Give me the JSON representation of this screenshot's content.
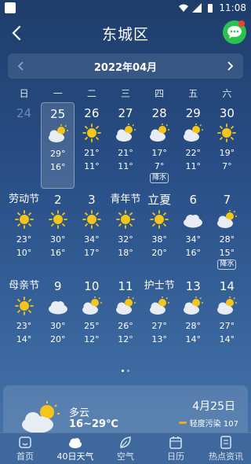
{
  "status": {
    "time": "11:08"
  },
  "header": {
    "title": "东城区"
  },
  "month_bar": {
    "label": "2022年04月"
  },
  "weekdays": [
    "日",
    "一",
    "二",
    "三",
    "四",
    "五",
    "六"
  ],
  "days": [
    {
      "day": "24",
      "dim": true
    },
    {
      "day": "25",
      "icon": "partly-cloudy-icon",
      "high": "29°",
      "low": "16°",
      "selected": true
    },
    {
      "day": "26",
      "icon": "sun-icon",
      "high": "21°",
      "low": "11°"
    },
    {
      "day": "27",
      "icon": "partly-cloudy-icon",
      "high": "21°",
      "low": "11°"
    },
    {
      "day": "28",
      "icon": "partly-cloudy-icon",
      "high": "17°",
      "low": "7°",
      "badge": "降水"
    },
    {
      "day": "29",
      "icon": "partly-cloudy-icon",
      "high": "22°",
      "low": "11°"
    },
    {
      "day": "30",
      "icon": "sun-icon",
      "high": "19°",
      "low": "7°"
    },
    {
      "day": "劳动节",
      "icon": "sun-icon",
      "high": "23°",
      "low": "10°"
    },
    {
      "day": "2",
      "icon": "sun-icon",
      "high": "30°",
      "low": "16°"
    },
    {
      "day": "3",
      "icon": "sun-icon",
      "high": "34°",
      "low": "17°"
    },
    {
      "day": "青年节",
      "icon": "sun-icon",
      "high": "32°",
      "low": "18°"
    },
    {
      "day": "立夏",
      "icon": "sun-icon",
      "high": "38°",
      "low": "20°"
    },
    {
      "day": "6",
      "icon": "cloud-icon",
      "high": "34°",
      "low": "16°"
    },
    {
      "day": "7",
      "icon": "partly-cloudy-icon",
      "high": "28°",
      "low": "15°",
      "badge": "降水"
    },
    {
      "day": "母亲节",
      "icon": "sun-icon",
      "high": "23°",
      "low": "14°"
    },
    {
      "day": "9",
      "icon": "cloud-icon",
      "high": "30°",
      "low": "20°"
    },
    {
      "day": "10",
      "icon": "partly-cloudy-icon",
      "high": "25°",
      "low": "12°"
    },
    {
      "day": "11",
      "icon": "partly-cloudy-icon",
      "high": "26°",
      "low": "12°"
    },
    {
      "day": "护士节",
      "icon": "partly-cloudy-icon",
      "high": "27°",
      "low": "13°"
    },
    {
      "day": "13",
      "icon": "partly-cloudy-icon",
      "high": "28°",
      "low": "14°"
    },
    {
      "day": "14",
      "icon": "partly-cloudy-icon",
      "high": "27°",
      "low": "14°"
    }
  ],
  "detail": {
    "condition": "多云",
    "range": "16~29℃",
    "date": "4月25日",
    "aqi": "轻度污染 107"
  },
  "tabs": [
    {
      "label": "首页",
      "icon": "home-icon"
    },
    {
      "label": "40日天气",
      "icon": "cloud-tab-icon",
      "active": true
    },
    {
      "label": "空气",
      "icon": "leaf-icon"
    },
    {
      "label": "日历",
      "icon": "calendar-icon"
    },
    {
      "label": "热点资讯",
      "icon": "news-icon"
    }
  ],
  "colors": {
    "accent_green": "#2bc24f",
    "sun": "#f5c518",
    "aqi_orange": "#f5a623"
  }
}
